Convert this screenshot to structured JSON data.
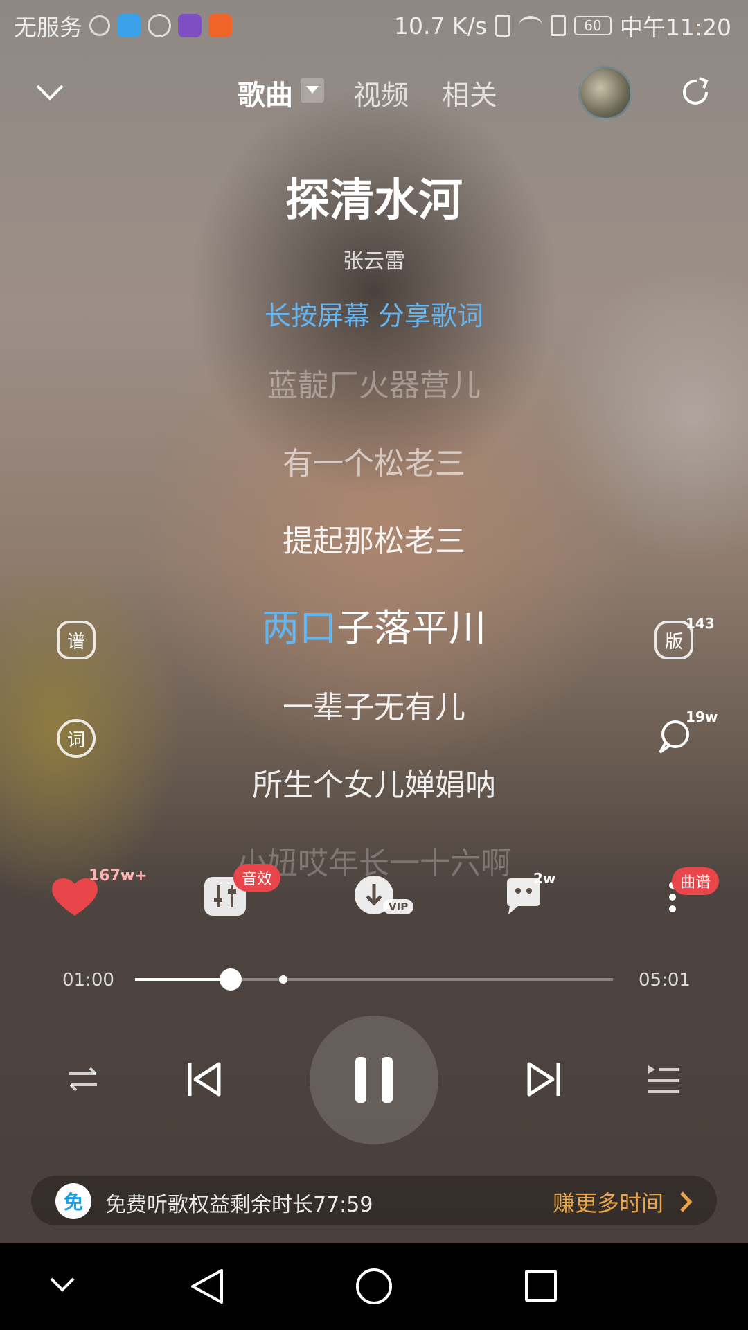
{
  "status_bar": {
    "carrier": "无服务",
    "network_speed": "10.7 K/s",
    "battery": "60",
    "time": "中午11:20"
  },
  "header": {
    "tabs": [
      {
        "label": "歌曲"
      },
      {
        "label": "视频"
      },
      {
        "label": "相关"
      }
    ]
  },
  "song": {
    "title": "探清水河",
    "artist": "张云雷",
    "share_hint": "长按屏幕 分享歌词"
  },
  "lyrics": {
    "lines": [
      "蓝靛厂火器营儿",
      "有一个松老三",
      "提起那松老三",
      "两口子落平川",
      "一辈子无有儿",
      "所生个女儿婵娟呐",
      "小妞哎年长一十六啊"
    ],
    "current_highlight": "两口",
    "current_rest": "子落平川"
  },
  "side_actions": {
    "score_label": "谱",
    "lyric_label": "词",
    "version_label": "版",
    "version_count": "143",
    "comment_count": "19w"
  },
  "actions": {
    "like_count": "167w+",
    "effects_badge": "音效",
    "download_badge": "VIP",
    "comments_count": "2w",
    "more_badge": "曲谱"
  },
  "player": {
    "current_time": "01:00",
    "total_time": "05:01",
    "progress": 0.2
  },
  "promo": {
    "icon_label": "免",
    "text": "免费听歌权益剩余时长77:59",
    "cta": "赚更多时间"
  },
  "colors": {
    "accent_blue": "#64b5f0",
    "like_red": "#e8464b",
    "promo_orange": "#e8a347"
  }
}
